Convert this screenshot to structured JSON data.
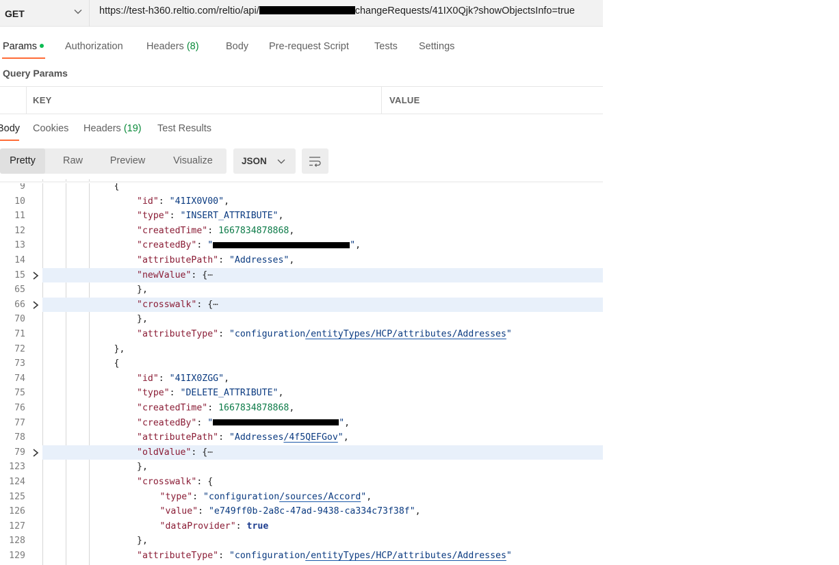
{
  "request": {
    "method": "GET",
    "url_prefix": "https://test-h360.reltio.com/reltio/api/",
    "url_suffix": "changeRequests/41IX0Qjk?showObjectsInfo=true"
  },
  "request_tabs": [
    {
      "label": "Params",
      "count": "",
      "active": true,
      "indicator": true
    },
    {
      "label": "Authorization",
      "count": ""
    },
    {
      "label": "Headers",
      "count": "(8)"
    },
    {
      "label": "Body",
      "count": ""
    },
    {
      "label": "Pre-request Script",
      "count": ""
    },
    {
      "label": "Tests",
      "count": ""
    },
    {
      "label": "Settings",
      "count": ""
    }
  ],
  "query_params": {
    "title": "Query Params",
    "columns": [
      "KEY",
      "VALUE"
    ]
  },
  "response_tabs": [
    {
      "label": "Body",
      "count": "",
      "active": true
    },
    {
      "label": "Cookies",
      "count": ""
    },
    {
      "label": "Headers",
      "count": "(19)"
    },
    {
      "label": "Test Results",
      "count": ""
    }
  ],
  "view_modes": [
    "Pretty",
    "Raw",
    "Preview",
    "Visualize"
  ],
  "active_view_mode": "Pretty",
  "format_select": "JSON",
  "icons": {
    "method_dropdown": "chevron-down-icon",
    "format_dropdown": "chevron-down-icon",
    "wrap_lines": "wrap-lines-icon",
    "fold": "chevron-right-icon"
  },
  "code_lines": [
    {
      "num": "9",
      "indent": 3,
      "tokens": [
        [
          "p",
          "{"
        ]
      ]
    },
    {
      "num": "10",
      "indent": 4,
      "tokens": [
        [
          "k",
          "\"id\""
        ],
        [
          "p",
          ": "
        ],
        [
          "s",
          "\"41IX0V00\""
        ],
        [
          "p",
          ","
        ]
      ]
    },
    {
      "num": "11",
      "indent": 4,
      "tokens": [
        [
          "k",
          "\"type\""
        ],
        [
          "p",
          ": "
        ],
        [
          "s",
          "\"INSERT_ATTRIBUTE\""
        ],
        [
          "p",
          ","
        ]
      ]
    },
    {
      "num": "12",
      "indent": 4,
      "tokens": [
        [
          "k",
          "\"createdTime\""
        ],
        [
          "p",
          ": "
        ],
        [
          "n",
          "1667834878868"
        ],
        [
          "p",
          ","
        ]
      ]
    },
    {
      "num": "13",
      "indent": 4,
      "tokens": [
        [
          "k",
          "\"createdBy\""
        ],
        [
          "p",
          ": "
        ],
        [
          "s",
          "\""
        ],
        [
          "redact",
          "200"
        ],
        [
          "s",
          "\""
        ],
        [
          "p",
          ","
        ]
      ]
    },
    {
      "num": "14",
      "indent": 4,
      "tokens": [
        [
          "k",
          "\"attributePath\""
        ],
        [
          "p",
          ": "
        ],
        [
          "s",
          "\"Addresses\""
        ],
        [
          "p",
          ","
        ]
      ]
    },
    {
      "num": "15",
      "indent": 4,
      "fold": true,
      "highlight": true,
      "tokens": [
        [
          "k",
          "\"newValue\""
        ],
        [
          "p",
          ": {"
        ],
        [
          "ell",
          "⋯"
        ]
      ]
    },
    {
      "num": "65",
      "indent": 4,
      "tokens": [
        [
          "p",
          "},"
        ]
      ]
    },
    {
      "num": "66",
      "indent": 4,
      "fold": true,
      "highlight": true,
      "tokens": [
        [
          "k",
          "\"crosswalk\""
        ],
        [
          "p",
          ": {"
        ],
        [
          "ell",
          "⋯"
        ]
      ]
    },
    {
      "num": "70",
      "indent": 4,
      "tokens": [
        [
          "p",
          "},"
        ]
      ]
    },
    {
      "num": "71",
      "indent": 4,
      "tokens": [
        [
          "k",
          "\"attributeType\""
        ],
        [
          "p",
          ": "
        ],
        [
          "s",
          "\"configuration"
        ],
        [
          "su",
          "/entityTypes/HCP/attributes/Addresses"
        ],
        [
          "s",
          "\""
        ]
      ]
    },
    {
      "num": "72",
      "indent": 3,
      "tokens": [
        [
          "p",
          "},"
        ]
      ]
    },
    {
      "num": "73",
      "indent": 3,
      "tokens": [
        [
          "p",
          "{"
        ]
      ]
    },
    {
      "num": "74",
      "indent": 4,
      "tokens": [
        [
          "k",
          "\"id\""
        ],
        [
          "p",
          ": "
        ],
        [
          "s",
          "\"41IX0ZGG\""
        ],
        [
          "p",
          ","
        ]
      ]
    },
    {
      "num": "75",
      "indent": 4,
      "tokens": [
        [
          "k",
          "\"type\""
        ],
        [
          "p",
          ": "
        ],
        [
          "s",
          "\"DELETE_ATTRIBUTE\""
        ],
        [
          "p",
          ","
        ]
      ]
    },
    {
      "num": "76",
      "indent": 4,
      "tokens": [
        [
          "k",
          "\"createdTime\""
        ],
        [
          "p",
          ": "
        ],
        [
          "n",
          "1667834878868"
        ],
        [
          "p",
          ","
        ]
      ]
    },
    {
      "num": "77",
      "indent": 4,
      "tokens": [
        [
          "k",
          "\"createdBy\""
        ],
        [
          "p",
          ": "
        ],
        [
          "s",
          "\""
        ],
        [
          "redact",
          "184"
        ],
        [
          "s",
          "\""
        ],
        [
          "p",
          ","
        ]
      ]
    },
    {
      "num": "78",
      "indent": 4,
      "tokens": [
        [
          "k",
          "\"attributePath\""
        ],
        [
          "p",
          ": "
        ],
        [
          "s",
          "\"Addresses"
        ],
        [
          "su",
          "/4f5QEFGov"
        ],
        [
          "s",
          "\""
        ],
        [
          "p",
          ","
        ]
      ]
    },
    {
      "num": "79",
      "indent": 4,
      "fold": true,
      "highlight": true,
      "tokens": [
        [
          "k",
          "\"oldValue\""
        ],
        [
          "p",
          ": {"
        ],
        [
          "ell",
          "⋯"
        ]
      ]
    },
    {
      "num": "123",
      "indent": 4,
      "tokens": [
        [
          "p",
          "},"
        ]
      ]
    },
    {
      "num": "124",
      "indent": 4,
      "tokens": [
        [
          "k",
          "\"crosswalk\""
        ],
        [
          "p",
          ": {"
        ]
      ]
    },
    {
      "num": "125",
      "indent": 5,
      "tokens": [
        [
          "k",
          "\"type\""
        ],
        [
          "p",
          ": "
        ],
        [
          "s",
          "\"configuration"
        ],
        [
          "su",
          "/sources/Accord"
        ],
        [
          "s",
          "\""
        ],
        [
          "p",
          ","
        ]
      ]
    },
    {
      "num": "126",
      "indent": 5,
      "tokens": [
        [
          "k",
          "\"value\""
        ],
        [
          "p",
          ": "
        ],
        [
          "s",
          "\"e749ff0b-2a8c-47ad-9438-ca334c73f38f\""
        ],
        [
          "p",
          ","
        ]
      ]
    },
    {
      "num": "127",
      "indent": 5,
      "tokens": [
        [
          "k",
          "\"dataProvider\""
        ],
        [
          "p",
          ": "
        ],
        [
          "b",
          "true"
        ]
      ]
    },
    {
      "num": "128",
      "indent": 4,
      "tokens": [
        [
          "p",
          "},"
        ]
      ]
    },
    {
      "num": "129",
      "indent": 4,
      "tokens": [
        [
          "k",
          "\"attributeType\""
        ],
        [
          "p",
          ": "
        ],
        [
          "s",
          "\"configuration"
        ],
        [
          "su",
          "/entityTypes/HCP/attributes/Addresses"
        ],
        [
          "s",
          "\""
        ]
      ]
    }
  ]
}
